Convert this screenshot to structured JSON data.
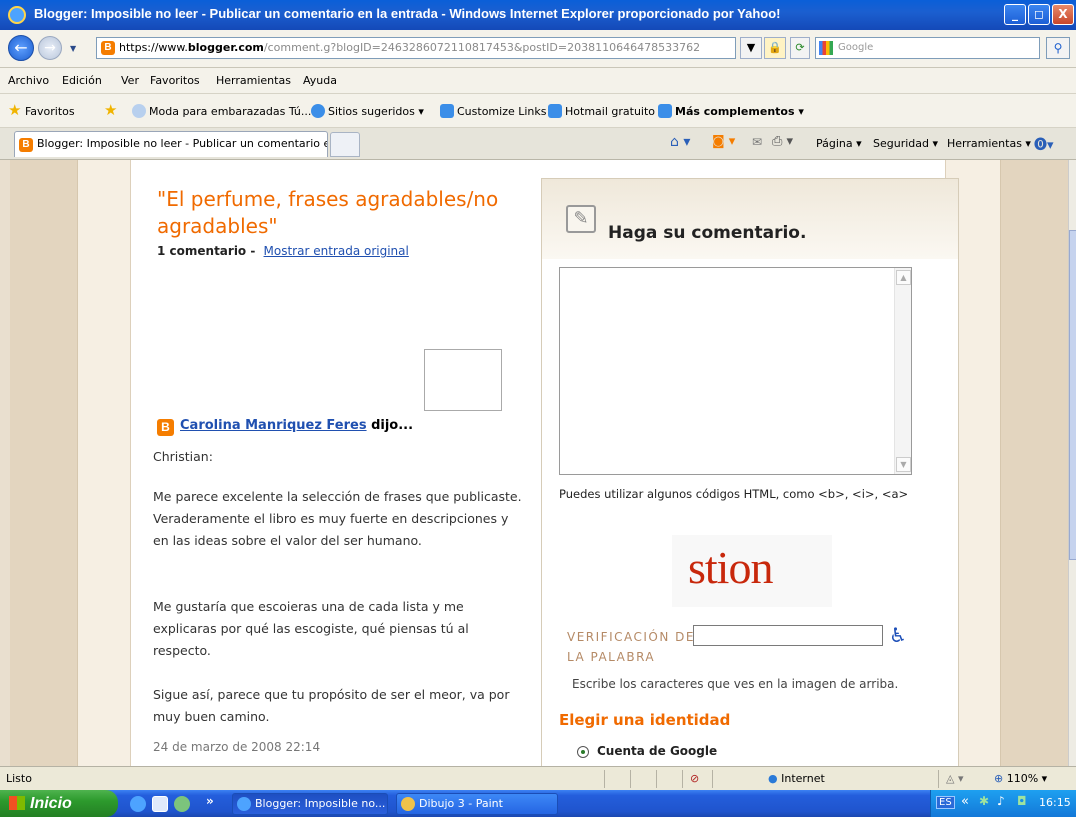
{
  "window": {
    "title": "Blogger: Imposible no leer - Publicar un comentario en la entrada - Windows Internet Explorer proporcionado por Yahoo!",
    "min_glyph": "_",
    "max_glyph": "◻",
    "close_glyph": "X"
  },
  "address": {
    "url_scheme": "https://www.",
    "url_host": "blogger.com",
    "url_path": "/comment.g?blogID=2463286072110817453&postID=2038110646478533762",
    "search_placeholder": "Google"
  },
  "menu": [
    "Archivo",
    "Edición",
    "Ver",
    "Favoritos",
    "Herramientas",
    "Ayuda"
  ],
  "favorites_bar": {
    "favorites": "Favoritos",
    "links": [
      "Moda para embarazadas Tú...",
      "Sitios sugeridos ▾",
      "Customize Links",
      "Hotmail gratuito",
      "Más complementos ▾"
    ]
  },
  "tab": {
    "label": "Blogger: Imposible no leer - Publicar un comentario en..."
  },
  "command_bar": {
    "page": "Página ▾",
    "security": "Seguridad ▾",
    "tools": "Herramientas ▾"
  },
  "post": {
    "title": "\"El perfume, frases agradables/no agradables\"",
    "comment_count": "1 comentario -",
    "show_original": "Mostrar entrada original",
    "author": "Carolina Manriquez Feres",
    "said": "dijo...",
    "paragraphs": [
      "Christian:",
      "Me parece excelente la selección de frases que publicaste. Veraderamente el libro es muy fuerte en descripciones y en las ideas sobre el valor del ser humano.",
      "Me gustaría que escoieras una de cada lista y me explicaras por qué las escogiste, qué piensas tú al respecto.",
      "Sigue así, parece que tu propósito de ser el meor, va por muy buen camino."
    ],
    "date": "24 de marzo de 2008 22:14"
  },
  "comment_form": {
    "heading": "Haga su comentario.",
    "html_hint": "Puedes utilizar algunos códigos HTML, como <b>, <i>, <a>",
    "captcha_text": "stion",
    "verification_label": "VERIFICACIÓN DE LA PALABRA",
    "verification_help": "Escribe los caracteres que ves en la imagen de arriba.",
    "identity_title": "Elegir una identidad",
    "identity_option": "Cuenta de Google"
  },
  "status_bar": {
    "status": "Listo",
    "zone": "Internet",
    "zoom": "110%"
  },
  "taskbar": {
    "start": "Inicio",
    "tasks": [
      "Blogger: Imposible no...",
      "Dibujo 3 - Paint"
    ],
    "lang": "ES",
    "clock": "16:15"
  }
}
